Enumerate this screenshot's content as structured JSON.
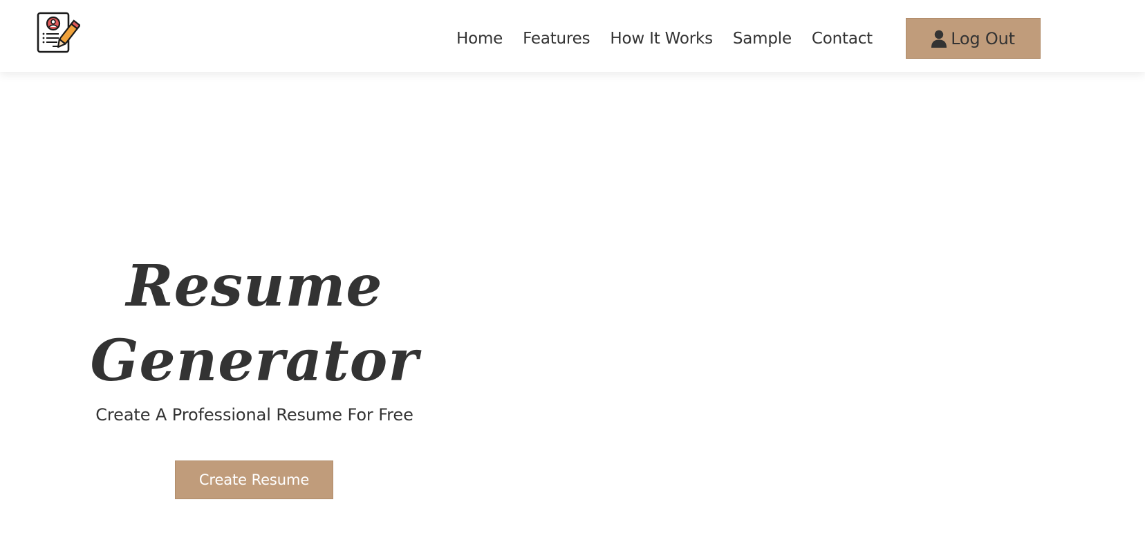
{
  "header": {
    "logo_icon": "resume-pencil-logo-icon",
    "nav": [
      {
        "label": "Home"
      },
      {
        "label": "Features"
      },
      {
        "label": "How It Works"
      },
      {
        "label": "Sample"
      },
      {
        "label": "Contact"
      }
    ],
    "logout": {
      "icon": "user-icon",
      "label": "Log Out"
    }
  },
  "hero": {
    "title_line1": "Resume",
    "title_line2": "Generator",
    "subtitle": "Create A Professional Resume For Free",
    "cta_label": "Create Resume"
  },
  "colors": {
    "accent": "#c09c7b",
    "text": "#333333",
    "background": "#ffffff",
    "logo_red": "#e05a5a",
    "pencil_orange": "#f0a23b"
  }
}
